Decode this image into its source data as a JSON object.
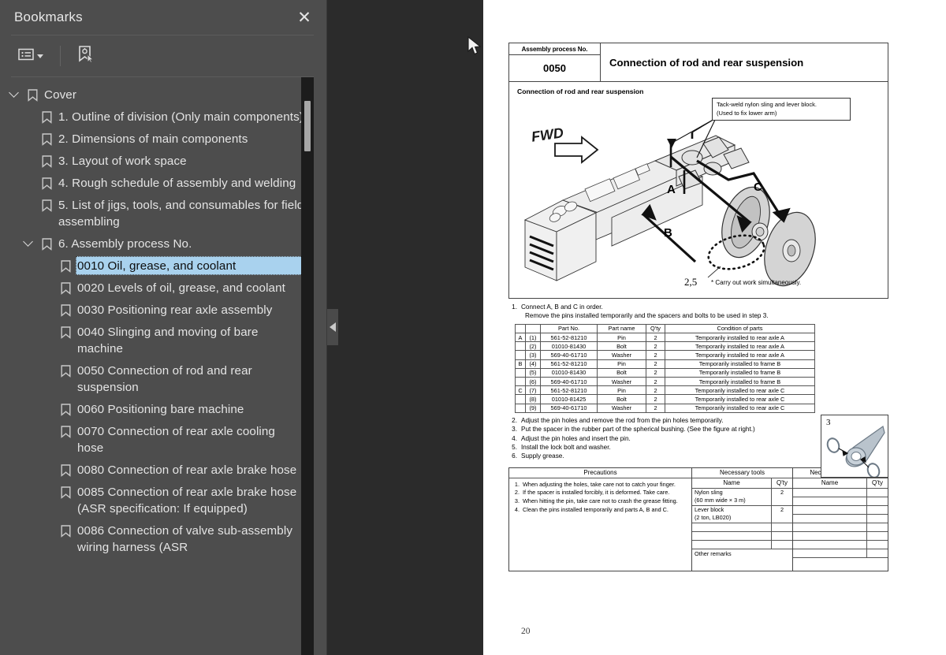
{
  "sidebar": {
    "title": "Bookmarks",
    "close_label": "✕",
    "toolbar": {
      "options_icon": "list-options-icon",
      "caret_icon": "chevron-down-icon",
      "add_bookmark_icon": "add-bookmark-icon"
    },
    "items": [
      {
        "level": 0,
        "label": "Cover",
        "expanded": true,
        "selected": false
      },
      {
        "level": 1,
        "label": "1. Outline of division (Only main components)",
        "expanded": null,
        "selected": false
      },
      {
        "level": 1,
        "label": "2. Dimensions of main components",
        "expanded": null,
        "selected": false
      },
      {
        "level": 1,
        "label": "3. Layout of work space",
        "expanded": null,
        "selected": false
      },
      {
        "level": 1,
        "label": "4. Rough schedule of assembly and welding",
        "expanded": null,
        "selected": false
      },
      {
        "level": 1,
        "label": "5. List of jigs, tools, and consumables for field assembling",
        "expanded": null,
        "selected": false
      },
      {
        "level": 1,
        "label": "6. Assembly process No.",
        "expanded": true,
        "selected": false
      },
      {
        "level": 2,
        "label": "0010 Oil, grease, and coolant",
        "expanded": null,
        "selected": true
      },
      {
        "level": 2,
        "label": "0020 Levels of oil, grease, and coolant",
        "expanded": null,
        "selected": false
      },
      {
        "level": 2,
        "label": "0030 Positioning rear axle assembly",
        "expanded": null,
        "selected": false
      },
      {
        "level": 2,
        "label": "0040 Slinging and moving of bare machine",
        "expanded": null,
        "selected": false
      },
      {
        "level": 2,
        "label": "0050 Connection of rod and rear suspension",
        "expanded": null,
        "selected": false
      },
      {
        "level": 2,
        "label": "0060 Positioning bare machine",
        "expanded": null,
        "selected": false
      },
      {
        "level": 2,
        "label": "0070 Connection of rear axle cooling hose",
        "expanded": null,
        "selected": false
      },
      {
        "level": 2,
        "label": "0080 Connection of rear axle brake hose",
        "expanded": null,
        "selected": false
      },
      {
        "level": 2,
        "label": "0085 Connection of rear axle brake hose (ASR specification: If equipped)",
        "expanded": null,
        "selected": false
      },
      {
        "level": 2,
        "label": "0086 Connection of valve sub-assembly wiring harness (ASR",
        "expanded": null,
        "selected": false
      }
    ]
  },
  "viewer": {
    "collapse_handle_icon": "triangle-left-icon",
    "page_number": "20"
  },
  "document": {
    "header": {
      "process_no_label": "Assembly process No.",
      "process_no": "0050",
      "title": "Connection of rod and rear suspension"
    },
    "figure": {
      "caption": "Connection of rod and rear suspension",
      "callout_box": "Tack-weld nylon sling and lever block.\n(Used to fix lower arm)",
      "direction_label": "FWD",
      "markers": {
        "a": "A",
        "b": "B",
        "c": "C"
      },
      "step_ref": "2,5",
      "simultaneous_note": "* Carry out work simultaneously."
    },
    "steps": [
      {
        "n": "1.",
        "text": "Connect A, B and C in order.",
        "sub": "Remove the pins installed temporarily and the spacers and bolts to be used in step 3."
      },
      {
        "n": "2.",
        "text": "Adjust the pin holes and remove the rod from the pin holes temporarily.",
        "sub": ""
      },
      {
        "n": "3.",
        "text": "Put the spacer in the rubber part of the spherical bushing.  (See the figure at right.)",
        "sub": ""
      },
      {
        "n": "4.",
        "text": "Adjust the pin holes and insert the pin.",
        "sub": ""
      },
      {
        "n": "5.",
        "text": "Install the lock bolt and washer.",
        "sub": ""
      },
      {
        "n": "6.",
        "text": "Supply grease.",
        "sub": ""
      }
    ],
    "parts_table": {
      "headers": [
        "",
        "",
        "Part No.",
        "Part name",
        "Q'ty",
        "Condition of parts"
      ],
      "rows": [
        {
          "group": "A",
          "idx": "(1)",
          "part_no": "561-52-81210",
          "part_name": "Pin",
          "qty": "2",
          "condition": "Temporarily installed to rear axle A"
        },
        {
          "group": "",
          "idx": "(2)",
          "part_no": "01010-81430",
          "part_name": "Bolt",
          "qty": "2",
          "condition": "Temporarily installed to rear axle A"
        },
        {
          "group": "",
          "idx": "(3)",
          "part_no": "569-40-61710",
          "part_name": "Washer",
          "qty": "2",
          "condition": "Temporarily installed to rear axle A"
        },
        {
          "group": "B",
          "idx": "(4)",
          "part_no": "561-52-81210",
          "part_name": "Pin",
          "qty": "2",
          "condition": "Temporarily installed to frame B"
        },
        {
          "group": "",
          "idx": "(5)",
          "part_no": "01010-81430",
          "part_name": "Bolt",
          "qty": "2",
          "condition": "Temporarily installed to frame B"
        },
        {
          "group": "",
          "idx": "(6)",
          "part_no": "569-40-61710",
          "part_name": "Washer",
          "qty": "2",
          "condition": "Temporarily installed to frame B"
        },
        {
          "group": "C",
          "idx": "(7)",
          "part_no": "561-52-81210",
          "part_name": "Pin",
          "qty": "2",
          "condition": "Temporarily installed to rear axle C"
        },
        {
          "group": "",
          "idx": "(8)",
          "part_no": "01010-81425",
          "part_name": "Bolt",
          "qty": "2",
          "condition": "Temporarily installed to rear axle C"
        },
        {
          "group": "",
          "idx": "(9)",
          "part_no": "569-40-61710",
          "part_name": "Washer",
          "qty": "2",
          "condition": "Temporarily installed to rear axle C"
        }
      ]
    },
    "detail_figure": {
      "number": "3"
    },
    "bottom": {
      "precautions_header": "Precautions",
      "tools_header": "Necessary tools",
      "equipment_header": "Necessary equipment",
      "name_header": "Name",
      "qty_header": "Q'ty",
      "precautions": [
        {
          "n": "1.",
          "text": "When adjusting the holes, take care not to catch your finger."
        },
        {
          "n": "2.",
          "text": "If the spacer is installed forcibly, it is deformed.  Take care."
        },
        {
          "n": "3.",
          "text": "When hitting the pin, take care not to crash the grease fitting."
        },
        {
          "n": "4.",
          "text": "Clean the pins installed temporarily and parts A, B and C."
        }
      ],
      "tools": [
        {
          "name": "Nylon sling",
          "name2": "(60 mm wide × 3 m)",
          "qty": "2"
        },
        {
          "name": "Lever block",
          "name2": "(2 ton, LB020)",
          "qty": "2"
        },
        {
          "name": "",
          "name2": "",
          "qty": ""
        },
        {
          "name": "",
          "name2": "",
          "qty": ""
        },
        {
          "name": "",
          "name2": "",
          "qty": ""
        }
      ],
      "equipment": [
        {
          "name": "",
          "qty": ""
        },
        {
          "name": "",
          "qty": ""
        },
        {
          "name": "",
          "qty": ""
        },
        {
          "name": "",
          "qty": ""
        },
        {
          "name": "",
          "qty": ""
        },
        {
          "name": "",
          "qty": ""
        },
        {
          "name": "",
          "qty": ""
        },
        {
          "name": "",
          "qty": ""
        }
      ],
      "other_remarks": "Other remarks"
    }
  },
  "colors": {
    "sidebar_bg": "#4d4d4d",
    "viewer_bg": "#2b2b2b",
    "selection": "#a9d2ee",
    "page_bg": "#ffffff"
  }
}
